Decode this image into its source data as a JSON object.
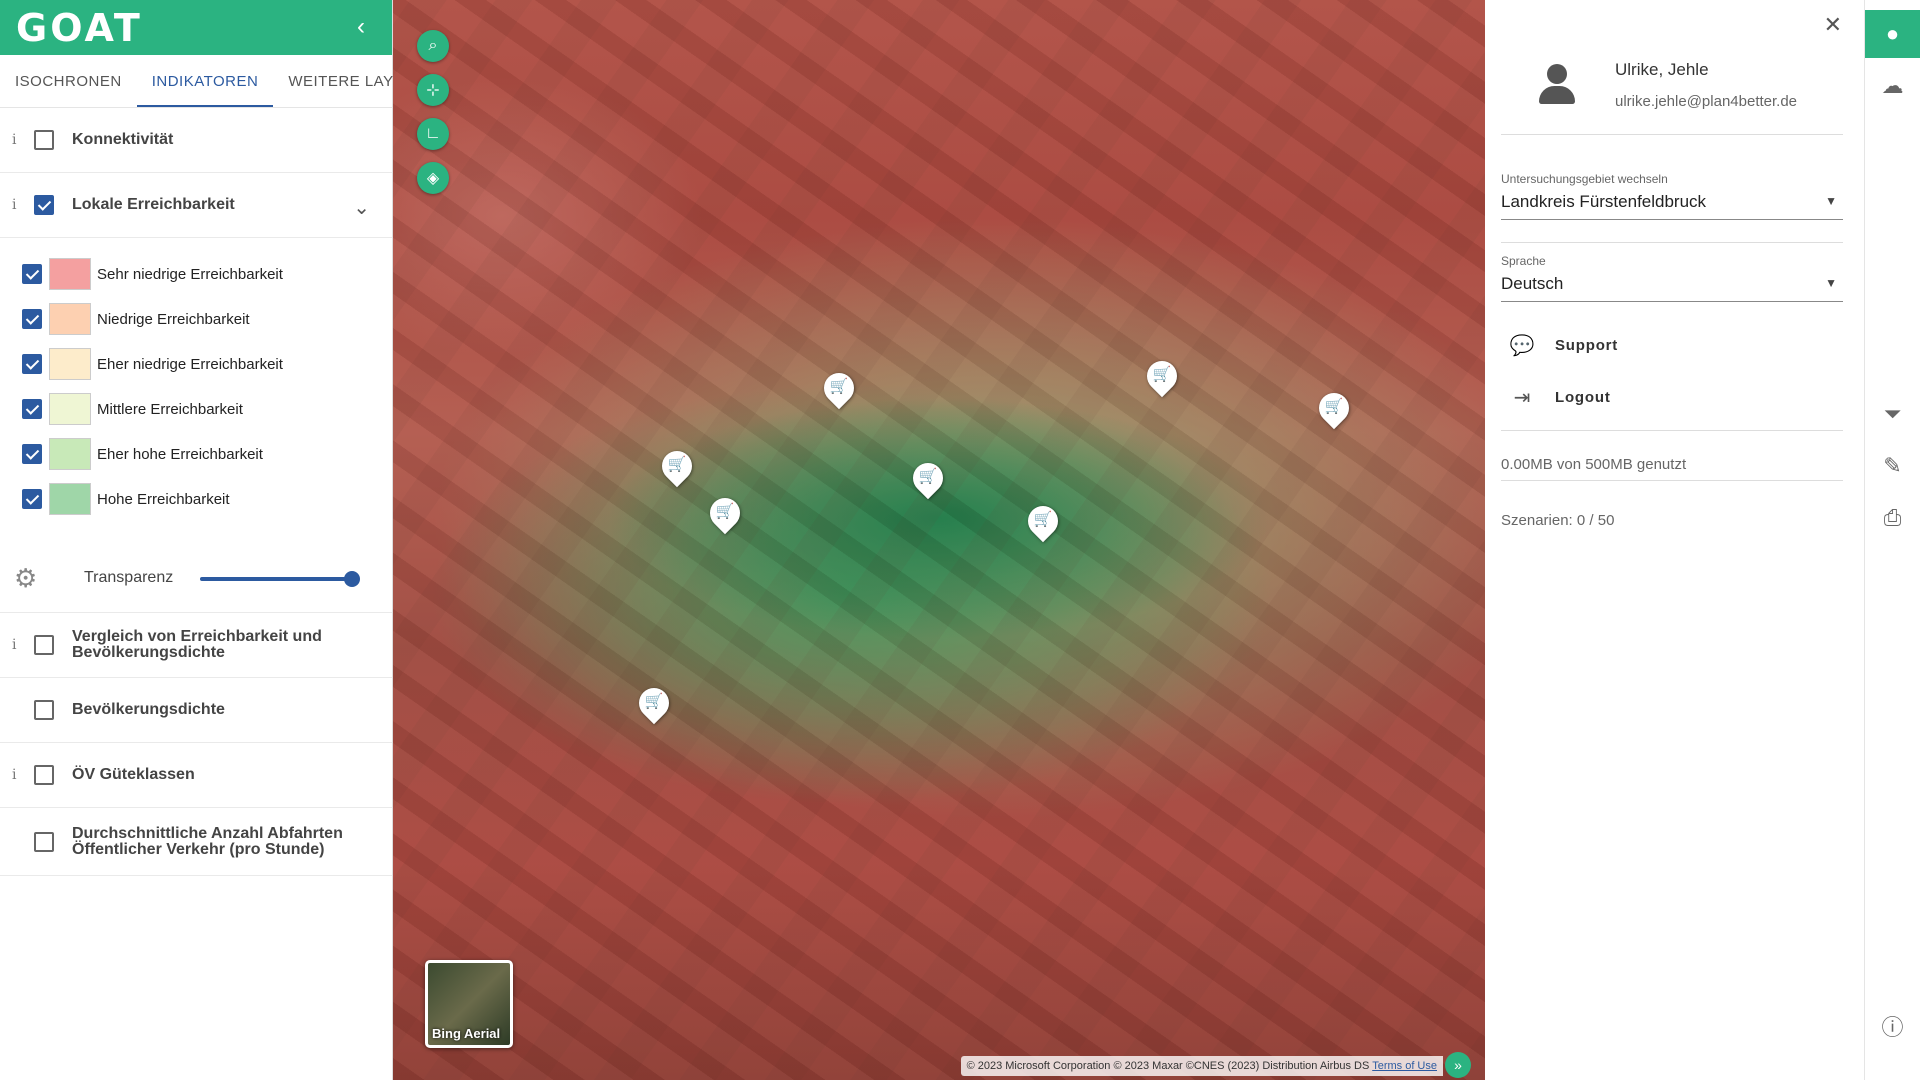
{
  "brand": {
    "logo": "GOAT",
    "collapse_icon": "chevron-left-icon"
  },
  "tabs": [
    {
      "label": "ISOCHRONEN"
    },
    {
      "label": "INDIKATOREN",
      "active": true
    },
    {
      "label": "WEITERE LAYER"
    }
  ],
  "layers": {
    "konnektivitaet": {
      "label": "Konnektivität",
      "checked": false,
      "info": "i"
    },
    "lokale": {
      "label": "Lokale Erreichbarkeit",
      "checked": true,
      "info": "i"
    },
    "vergleich": {
      "label": "Vergleich von Erreichbarkeit und Bevölkerungsdichte",
      "checked": false,
      "info": "i"
    },
    "bevoelkerung": {
      "label": "Bevölkerungsdichte",
      "checked": false
    },
    "oev": {
      "label": "ÖV Güteklassen",
      "checked": false,
      "info": "i"
    },
    "abfahrten": {
      "label": "Durchschnittliche Anzahl Abfahrten Öffentlicher Verkehr (pro Stunde)",
      "checked": false
    }
  },
  "legend": [
    {
      "label": "Sehr niedrige Erreichbarkeit",
      "color": "#f4a0a0",
      "checked": true
    },
    {
      "label": "Niedrige Erreichbarkeit",
      "color": "#fdd0b1",
      "checked": true
    },
    {
      "label": "Eher niedrige Erreichbarkeit",
      "color": "#fdeccb",
      "checked": true
    },
    {
      "label": "Mittlere Erreichbarkeit",
      "color": "#eff6d4",
      "checked": true
    },
    {
      "label": "Eher hohe Erreichbarkeit",
      "color": "#c8e9b8",
      "checked": true
    },
    {
      "label": "Hohe Erreichbarkeit",
      "color": "#9fd6a8",
      "checked": true
    }
  ],
  "transparency": {
    "label": "Transparenz",
    "value": 0.95
  },
  "map": {
    "basemap_label": "Bing Aerial",
    "attribution": "© 2023 Microsoft Corporation © 2023 Maxar ©CNES (2023) Distribution Airbus DS",
    "terms_link": "Terms of Use",
    "tools": [
      "search-icon",
      "fit-extent-icon",
      "measure-icon",
      "layers-icon"
    ],
    "poi_icon": "shopping-cart-icon"
  },
  "user": {
    "name": "Ulrike, Jehle",
    "email": "ulrike.jehle@plan4better.de",
    "study_area_label": "Untersuchungsgebiet wechseln",
    "study_area_value": "Landkreis Fürstenfeldbruck",
    "language_label": "Sprache",
    "language_value": "Deutsch",
    "support_label": "Support",
    "logout_label": "Logout",
    "storage": "0.00MB von 500MB genutzt",
    "scenarios": "Szenarien: 0 / 50"
  },
  "colors": {
    "brand": "#2bb381",
    "accent": "#2c5aa0"
  },
  "toolbar_icons": [
    "account-icon",
    "cloud-icon",
    "filter-icon",
    "edit-icon",
    "print-icon",
    "info-icon"
  ]
}
